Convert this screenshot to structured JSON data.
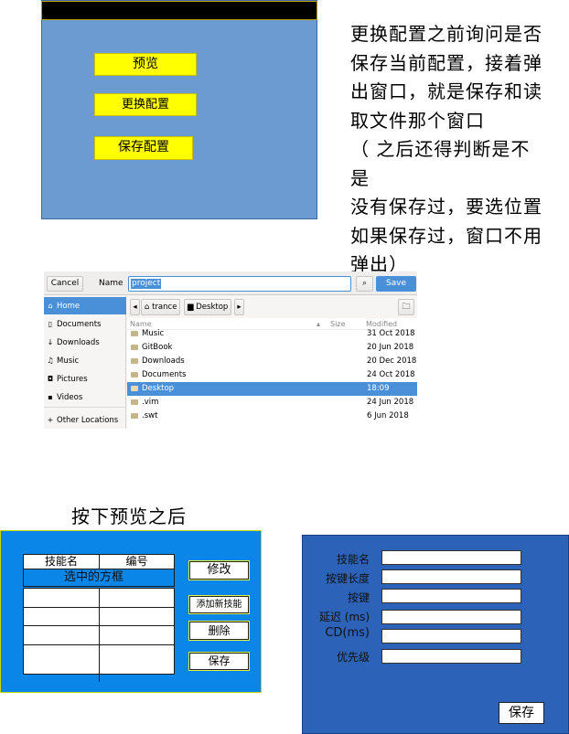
{
  "top_mock": {
    "buttons": [
      "预览",
      "更换配置",
      "保存配置"
    ]
  },
  "note_lines": [
    "更换配置之前询问是否",
    "保存当前配置，接着弹",
    "出窗口，就是保存和读",
    "取文件那个窗口",
    "（ 之后还得判断是不是",
    "没有保存过，要选位置",
    "如果保存过，窗口不用",
    "弹出）"
  ],
  "dialog": {
    "cancel": "Cancel",
    "name_label": "Name",
    "name_value": "project",
    "save": "Save",
    "sidebar": [
      {
        "label": "Home",
        "icon": "home-icon",
        "glyph": "⌂"
      },
      {
        "label": "Documents",
        "icon": "document-icon",
        "glyph": "▯"
      },
      {
        "label": "Downloads",
        "icon": "download-icon",
        "glyph": "↓"
      },
      {
        "label": "Music",
        "icon": "music-icon",
        "glyph": "♫"
      },
      {
        "label": "Pictures",
        "icon": "camera-icon",
        "glyph": "◘"
      },
      {
        "label": "Videos",
        "icon": "video-icon",
        "glyph": "▪"
      },
      {
        "label": "Other Locations",
        "icon": "plus-icon",
        "glyph": "+"
      }
    ],
    "path": [
      "trance",
      "Desktop"
    ],
    "columns": {
      "name": "Name",
      "size": "Size",
      "modified": "Modified"
    },
    "files": [
      {
        "name": "Music",
        "modified": "31 Oct 2018"
      },
      {
        "name": "GitBook",
        "modified": "20 Jun 2018"
      },
      {
        "name": "Downloads",
        "modified": "20 Dec 2018"
      },
      {
        "name": "Documents",
        "modified": "24 Oct 2018"
      },
      {
        "name": "Desktop",
        "modified": "18:09"
      },
      {
        "name": ".vim",
        "modified": "24 Jun 2018"
      },
      {
        "name": ".swt",
        "modified": "6 Jun 2018"
      }
    ]
  },
  "after_caption": "按下预览之后",
  "bottom_left": {
    "col_headers": [
      "技能名",
      "编号"
    ],
    "selected_row": "选中的方框",
    "buttons": [
      "修改",
      "添加新技能",
      "删除",
      "保存"
    ]
  },
  "bottom_right": {
    "fields": [
      "技能名",
      "按键长度",
      "按键",
      "延迟 (ms)",
      "CD(ms)",
      "优先级"
    ],
    "save": "保存"
  },
  "colors": {
    "accent_blue": "#4a90d9",
    "mock_yellow": "#ffff00",
    "mock_blue": "#0a86e8"
  }
}
